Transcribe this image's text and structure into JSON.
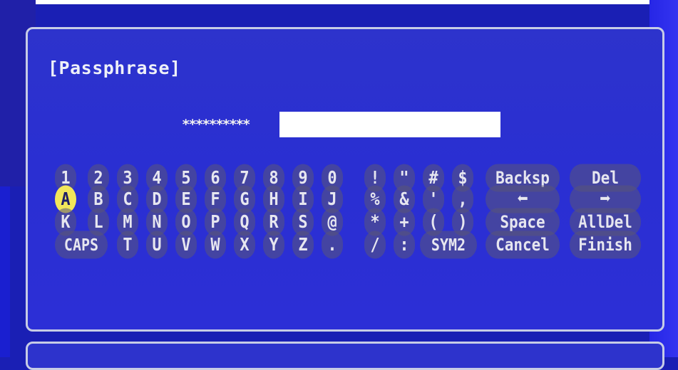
{
  "dialog": {
    "title": "[Passphrase]",
    "masked_value": "**********",
    "input_value": ""
  },
  "keyboard": {
    "rows": [
      [
        "1",
        "2",
        "3",
        "4",
        "5",
        "6",
        "7",
        "8",
        "9",
        "0",
        "!",
        "\"",
        "#",
        "$"
      ],
      [
        "A",
        "B",
        "C",
        "D",
        "E",
        "F",
        "G",
        "H",
        "I",
        "J",
        "%",
        "&",
        "'",
        ","
      ],
      [
        "K",
        "L",
        "M",
        "N",
        "O",
        "P",
        "Q",
        "R",
        "S",
        "@",
        "*",
        "+",
        "(",
        ")"
      ],
      [
        "CAPS",
        "T",
        "U",
        "V",
        "W",
        "X",
        "Y",
        "Z",
        ".",
        "/",
        ":",
        "SYM2"
      ]
    ],
    "selected_key": "A",
    "controls": {
      "backsp": "Backsp",
      "del": "Del",
      "left_arrow": "⬅",
      "right_arrow": "➡",
      "space": "Space",
      "alldel": "AllDel",
      "cancel": "Cancel",
      "finish": "Finish"
    }
  },
  "colors": {
    "background": "#1a1fb4",
    "panel": "#2d33cc",
    "panel_border": "#c7cce6",
    "selected_key": "#f2e65a",
    "key_text": "#e6e6ef"
  }
}
